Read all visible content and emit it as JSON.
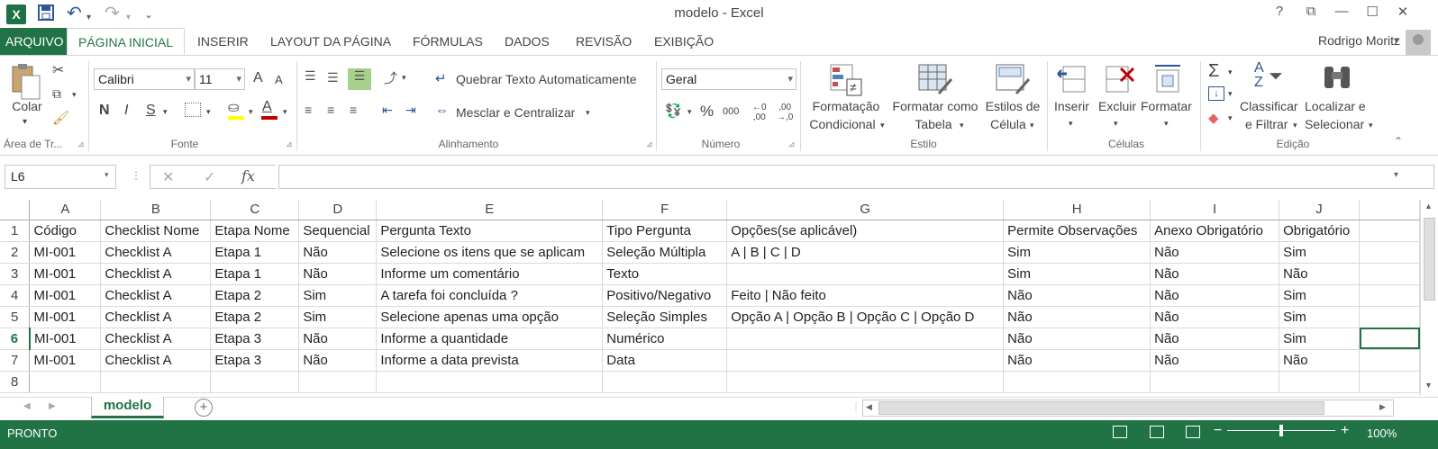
{
  "window": {
    "title": "modelo - Excel",
    "help": "?",
    "ribbon_display": "⧉",
    "minimize": "—",
    "maximize": "☐",
    "close": "✕"
  },
  "qat": {
    "logo": "X",
    "save_icon": "save-icon",
    "undo": "↶",
    "redo": "↷",
    "customize": "⌄"
  },
  "tabs": [
    {
      "label": "ARQUIVO"
    },
    {
      "label": "PÁGINA INICIAL"
    },
    {
      "label": "INSERIR"
    },
    {
      "label": "LAYOUT DA PÁGINA"
    },
    {
      "label": "FÓRMULAS"
    },
    {
      "label": "DADOS"
    },
    {
      "label": "REVISÃO"
    },
    {
      "label": "EXIBIÇÃO"
    }
  ],
  "user": {
    "name": "Rodrigo Moritz"
  },
  "ribbon": {
    "clipboard": {
      "paste": "Colar",
      "label": "Área de Tr..."
    },
    "font": {
      "name": "Calibri",
      "size": "11",
      "bold": "N",
      "italic": "I",
      "underline": "S",
      "label": "Fonte",
      "grow": "A",
      "shrink": "A",
      "highlight_color": "#ffff00",
      "font_color": "#c00000"
    },
    "alignment": {
      "wrap": "Quebrar Texto Automaticamente",
      "merge": "Mesclar e Centralizar",
      "label": "Alinhamento"
    },
    "number": {
      "format": "Geral",
      "percent": "%",
      "thousands": "000",
      "inc_dec": ",00",
      "label": "Número"
    },
    "styles": {
      "conditional_1": "Formatação",
      "conditional_2": "Condicional",
      "table_1": "Formatar como",
      "table_2": "Tabela",
      "cell_1": "Estilos de",
      "cell_2": "Célula",
      "label": "Estilo"
    },
    "cells": {
      "insert": "Inserir",
      "delete": "Excluir",
      "format": "Formatar",
      "label": "Células"
    },
    "editing": {
      "sort_1": "Classificar",
      "sort_2": "e Filtrar",
      "find_1": "Localizar e",
      "find_2": "Selecionar",
      "label": "Edição"
    }
  },
  "formula_bar": {
    "name_box": "L6",
    "fx": "fx",
    "cancel": "✕",
    "enter": "✓",
    "value": ""
  },
  "columns": [
    "A",
    "B",
    "C",
    "D",
    "E",
    "F",
    "G",
    "H",
    "I",
    "J"
  ],
  "rows": [
    {
      "n": "1",
      "cells": [
        "Código",
        "Checklist Nome",
        "Etapa Nome",
        "Sequencial",
        "Pergunta Texto",
        "Tipo Pergunta",
        "Opções(se aplicável)",
        "Permite Observações",
        "Anexo Obrigatório",
        "Obrigatório"
      ]
    },
    {
      "n": "2",
      "cells": [
        "MI-001",
        "Checklist A",
        "Etapa 1",
        "Não",
        "Selecione os itens que se aplicam",
        "Seleção Múltipla",
        "A | B | C | D",
        "Sim",
        "Não",
        "Sim"
      ]
    },
    {
      "n": "3",
      "cells": [
        "MI-001",
        "Checklist A",
        "Etapa 1",
        "Não",
        "Informe um comentário",
        "Texto",
        "",
        "Sim",
        "Não",
        "Não"
      ]
    },
    {
      "n": "4",
      "cells": [
        "MI-001",
        "Checklist A",
        "Etapa 2",
        "Sim",
        "A tarefa foi concluída ?",
        "Positivo/Negativo",
        "Feito | Não feito",
        "Não",
        "Não",
        "Sim"
      ]
    },
    {
      "n": "5",
      "cells": [
        "MI-001",
        "Checklist A",
        "Etapa 2",
        "Sim",
        "Selecione apenas uma opção",
        "Seleção Simples",
        "Opção A | Opção B | Opção C | Opção D",
        "Não",
        "Não",
        "Sim"
      ]
    },
    {
      "n": "6",
      "cells": [
        "MI-001",
        "Checklist A",
        "Etapa 3",
        "Não",
        "Informe a quantidade",
        "Numérico",
        "",
        "Não",
        "Não",
        "Sim"
      ]
    },
    {
      "n": "7",
      "cells": [
        "MI-001",
        "Checklist A",
        "Etapa 3",
        "Não",
        "Informe a data prevista",
        "Data",
        "",
        "Não",
        "Não",
        "Não"
      ]
    },
    {
      "n": "8",
      "cells": [
        "",
        "",
        "",
        "",
        "",
        "",
        "",
        "",
        "",
        ""
      ]
    }
  ],
  "sheets": [
    {
      "name": "modelo"
    }
  ],
  "status": {
    "ready": "PRONTO",
    "zoom": "100%",
    "zoom_level_percent": 100,
    "minus": "−",
    "plus": "+"
  },
  "colors": {
    "accent": "#217346"
  }
}
